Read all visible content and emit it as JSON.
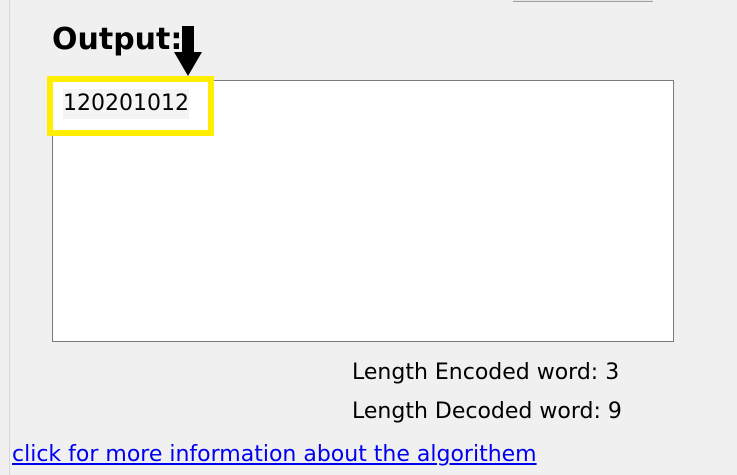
{
  "output": {
    "heading": "Output:",
    "value": "120201012"
  },
  "stats": {
    "encoded_label": "Length Encoded word:",
    "encoded_value": "3",
    "decoded_label": "Length Decoded word:",
    "decoded_value": "9"
  },
  "link": {
    "label": "click for more information about the algorithem"
  },
  "annotations": {
    "arrow_icon": "down-arrow-icon",
    "highlight_color": "#ffee00"
  },
  "colors": {
    "background": "#f0f0f0",
    "link": "#0000ee"
  }
}
